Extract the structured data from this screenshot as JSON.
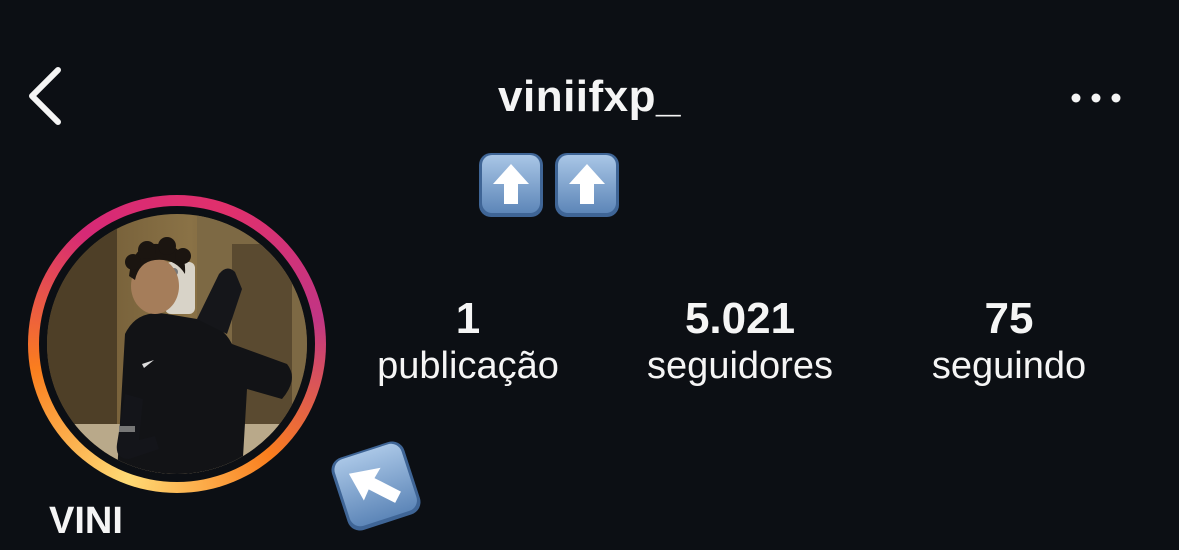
{
  "header": {
    "back_icon": "chevron-left-icon",
    "username": "viniifxp_",
    "more_icon": "ellipsis-icon"
  },
  "bio_emojis": [
    "up-arrow-key-emoji",
    "up-arrow-key-emoji"
  ],
  "avatar": {
    "has_story_ring": true,
    "ring_colors": [
      "#feda75",
      "#fa7e1e",
      "#d62976",
      "#c13584"
    ]
  },
  "stats": {
    "posts": {
      "value": "1",
      "label": "publicação"
    },
    "followers": {
      "value": "5.021",
      "label": "seguidores"
    },
    "following": {
      "value": "75",
      "label": "seguindo"
    }
  },
  "decorations": {
    "arrow_emoji": "up-left-arrow-key-emoji"
  },
  "profile": {
    "display_name": "VINI"
  },
  "colors": {
    "background": "#0c0f14",
    "text": "#f5f5f5"
  }
}
